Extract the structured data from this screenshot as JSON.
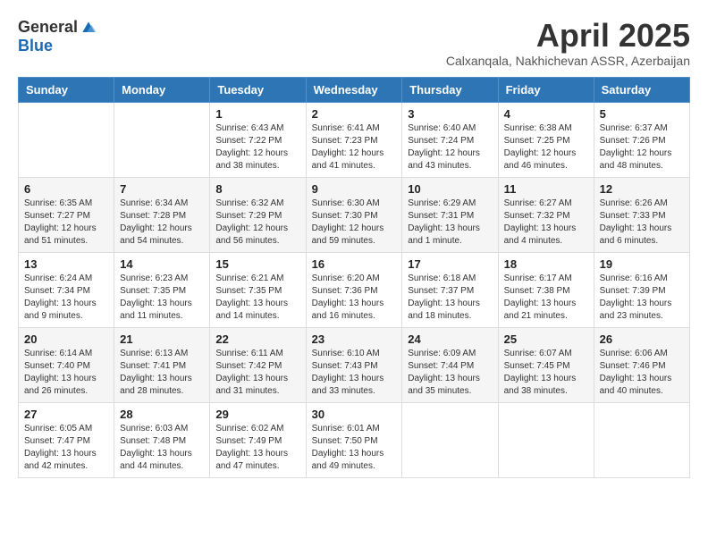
{
  "logo": {
    "general": "General",
    "blue": "Blue"
  },
  "title": "April 2025",
  "location": "Calxanqala, Nakhichevan ASSR, Azerbaijan",
  "weekdays": [
    "Sunday",
    "Monday",
    "Tuesday",
    "Wednesday",
    "Thursday",
    "Friday",
    "Saturday"
  ],
  "weeks": [
    [
      {
        "day": "",
        "info": ""
      },
      {
        "day": "",
        "info": ""
      },
      {
        "day": "1",
        "info": "Sunrise: 6:43 AM\nSunset: 7:22 PM\nDaylight: 12 hours and 38 minutes."
      },
      {
        "day": "2",
        "info": "Sunrise: 6:41 AM\nSunset: 7:23 PM\nDaylight: 12 hours and 41 minutes."
      },
      {
        "day": "3",
        "info": "Sunrise: 6:40 AM\nSunset: 7:24 PM\nDaylight: 12 hours and 43 minutes."
      },
      {
        "day": "4",
        "info": "Sunrise: 6:38 AM\nSunset: 7:25 PM\nDaylight: 12 hours and 46 minutes."
      },
      {
        "day": "5",
        "info": "Sunrise: 6:37 AM\nSunset: 7:26 PM\nDaylight: 12 hours and 48 minutes."
      }
    ],
    [
      {
        "day": "6",
        "info": "Sunrise: 6:35 AM\nSunset: 7:27 PM\nDaylight: 12 hours and 51 minutes."
      },
      {
        "day": "7",
        "info": "Sunrise: 6:34 AM\nSunset: 7:28 PM\nDaylight: 12 hours and 54 minutes."
      },
      {
        "day": "8",
        "info": "Sunrise: 6:32 AM\nSunset: 7:29 PM\nDaylight: 12 hours and 56 minutes."
      },
      {
        "day": "9",
        "info": "Sunrise: 6:30 AM\nSunset: 7:30 PM\nDaylight: 12 hours and 59 minutes."
      },
      {
        "day": "10",
        "info": "Sunrise: 6:29 AM\nSunset: 7:31 PM\nDaylight: 13 hours and 1 minute."
      },
      {
        "day": "11",
        "info": "Sunrise: 6:27 AM\nSunset: 7:32 PM\nDaylight: 13 hours and 4 minutes."
      },
      {
        "day": "12",
        "info": "Sunrise: 6:26 AM\nSunset: 7:33 PM\nDaylight: 13 hours and 6 minutes."
      }
    ],
    [
      {
        "day": "13",
        "info": "Sunrise: 6:24 AM\nSunset: 7:34 PM\nDaylight: 13 hours and 9 minutes."
      },
      {
        "day": "14",
        "info": "Sunrise: 6:23 AM\nSunset: 7:35 PM\nDaylight: 13 hours and 11 minutes."
      },
      {
        "day": "15",
        "info": "Sunrise: 6:21 AM\nSunset: 7:35 PM\nDaylight: 13 hours and 14 minutes."
      },
      {
        "day": "16",
        "info": "Sunrise: 6:20 AM\nSunset: 7:36 PM\nDaylight: 13 hours and 16 minutes."
      },
      {
        "day": "17",
        "info": "Sunrise: 6:18 AM\nSunset: 7:37 PM\nDaylight: 13 hours and 18 minutes."
      },
      {
        "day": "18",
        "info": "Sunrise: 6:17 AM\nSunset: 7:38 PM\nDaylight: 13 hours and 21 minutes."
      },
      {
        "day": "19",
        "info": "Sunrise: 6:16 AM\nSunset: 7:39 PM\nDaylight: 13 hours and 23 minutes."
      }
    ],
    [
      {
        "day": "20",
        "info": "Sunrise: 6:14 AM\nSunset: 7:40 PM\nDaylight: 13 hours and 26 minutes."
      },
      {
        "day": "21",
        "info": "Sunrise: 6:13 AM\nSunset: 7:41 PM\nDaylight: 13 hours and 28 minutes."
      },
      {
        "day": "22",
        "info": "Sunrise: 6:11 AM\nSunset: 7:42 PM\nDaylight: 13 hours and 31 minutes."
      },
      {
        "day": "23",
        "info": "Sunrise: 6:10 AM\nSunset: 7:43 PM\nDaylight: 13 hours and 33 minutes."
      },
      {
        "day": "24",
        "info": "Sunrise: 6:09 AM\nSunset: 7:44 PM\nDaylight: 13 hours and 35 minutes."
      },
      {
        "day": "25",
        "info": "Sunrise: 6:07 AM\nSunset: 7:45 PM\nDaylight: 13 hours and 38 minutes."
      },
      {
        "day": "26",
        "info": "Sunrise: 6:06 AM\nSunset: 7:46 PM\nDaylight: 13 hours and 40 minutes."
      }
    ],
    [
      {
        "day": "27",
        "info": "Sunrise: 6:05 AM\nSunset: 7:47 PM\nDaylight: 13 hours and 42 minutes."
      },
      {
        "day": "28",
        "info": "Sunrise: 6:03 AM\nSunset: 7:48 PM\nDaylight: 13 hours and 44 minutes."
      },
      {
        "day": "29",
        "info": "Sunrise: 6:02 AM\nSunset: 7:49 PM\nDaylight: 13 hours and 47 minutes."
      },
      {
        "day": "30",
        "info": "Sunrise: 6:01 AM\nSunset: 7:50 PM\nDaylight: 13 hours and 49 minutes."
      },
      {
        "day": "",
        "info": ""
      },
      {
        "day": "",
        "info": ""
      },
      {
        "day": "",
        "info": ""
      }
    ]
  ]
}
